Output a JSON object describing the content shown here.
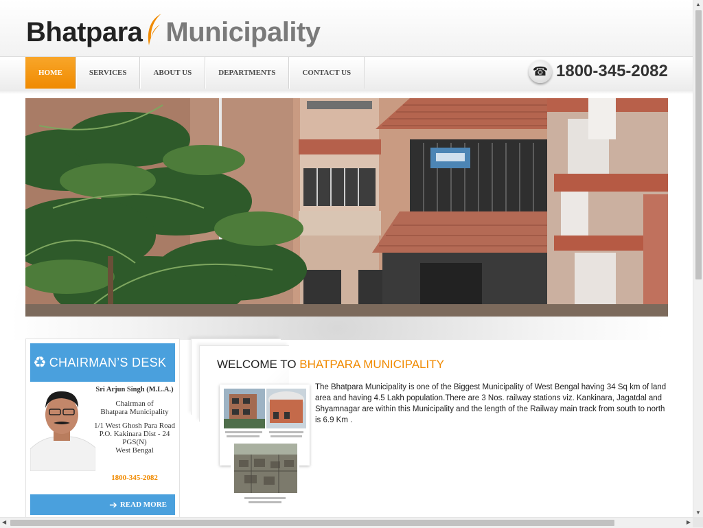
{
  "header": {
    "logo_part1": "Bhatpara",
    "logo_part2": "Municipality"
  },
  "nav": {
    "items": [
      {
        "label": "HOME",
        "active": true
      },
      {
        "label": "SERVICES",
        "active": false
      },
      {
        "label": "ABOUT US",
        "active": false
      },
      {
        "label": "DEPARTMENTS",
        "active": false
      },
      {
        "label": "CONTACT US",
        "active": false
      }
    ],
    "phone": "1800-345-2082"
  },
  "chairman": {
    "title": "CHAIRMAN’S DESK",
    "name": "Sri Arjun Singh (M.L.A.)",
    "role_line1": "Chairman of",
    "role_line2": "Bhatpara Municipality",
    "address": "1/1 West Ghosh Para Road P.O. Kakinara Dist - 24 PGS(N)",
    "state": "West Bengal",
    "phone": "1800-345-2082",
    "read_more": "READ MORE"
  },
  "welcome": {
    "heading_part1": "WELCOME TO",
    "heading_part2": "BHATPARA MUNICIPALITY",
    "text": "The Bhatpara Municipality is one of the Biggest Municipality of West Bengal having 34 Sq km of land area and having 4.5 Lakh population.There are 3 Nos. railway stations viz. Kankinara, Jagatdal and Shyamnagar are within this Municipality and the length of the Railway main track from south to north is 6.9 Km ."
  },
  "colors": {
    "accent_orange": "#f08a00",
    "accent_blue": "#4aa0dd"
  }
}
